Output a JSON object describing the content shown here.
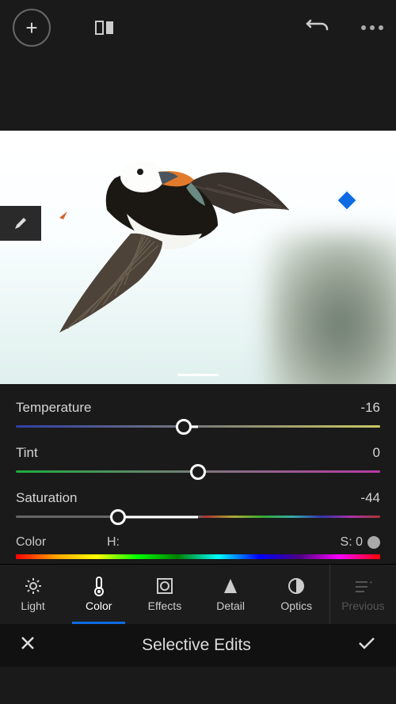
{
  "sliders": {
    "temperature": {
      "label": "Temperature",
      "value": -16,
      "pos": 46
    },
    "tint": {
      "label": "Tint",
      "value": 0,
      "pos": 50
    },
    "saturation": {
      "label": "Saturation",
      "value": -44,
      "pos": 28
    }
  },
  "colorRow": {
    "label": "Color",
    "hueLabel": "H:",
    "satLabel": "S: 0"
  },
  "tabs": {
    "light": "Light",
    "color": "Color",
    "effects": "Effects",
    "detail": "Detail",
    "optics": "Optics",
    "previous": "Previous"
  },
  "footer": {
    "title": "Selective Edits"
  }
}
